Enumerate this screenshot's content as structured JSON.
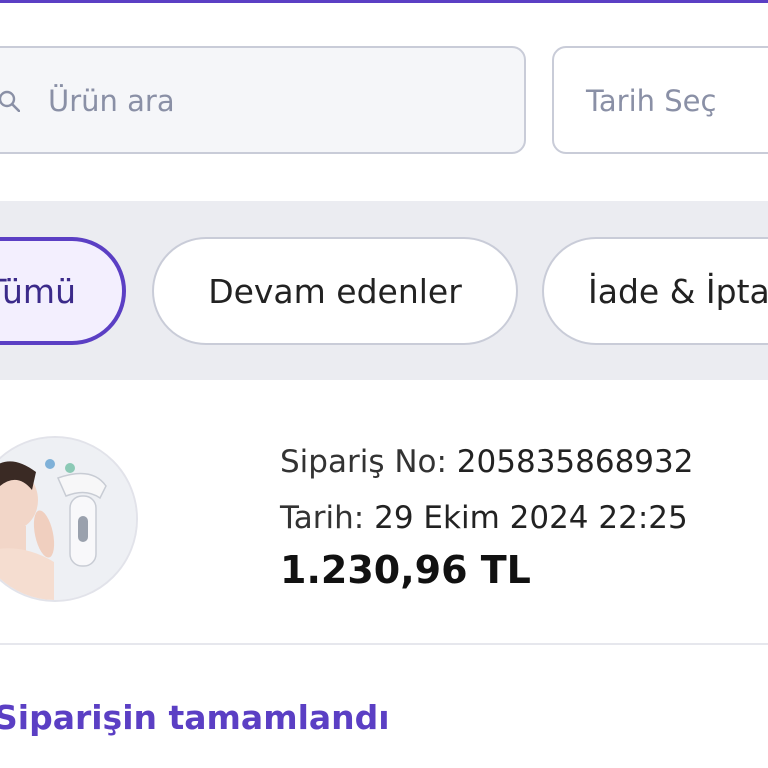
{
  "search": {
    "placeholder": "Ürün ara",
    "date_placeholder": "Tarih Seç"
  },
  "filters": {
    "all_label": "Tümü",
    "ongoing_label": "Devam edenler",
    "returns_label": "İade & İptal"
  },
  "order": {
    "order_no_label": "Sipariş No:",
    "order_no": "205835868932",
    "date_label": "Tarih:",
    "date": "29 Ekim 2024 22:25",
    "total": "1.230,96 TL",
    "status": "Siparişin tamamlandı",
    "product_icon": "face-massager-product-image"
  },
  "colors": {
    "accent": "#5b3fc4",
    "chip_selected_bg": "#f3effe",
    "band_bg": "#ebecf1"
  }
}
